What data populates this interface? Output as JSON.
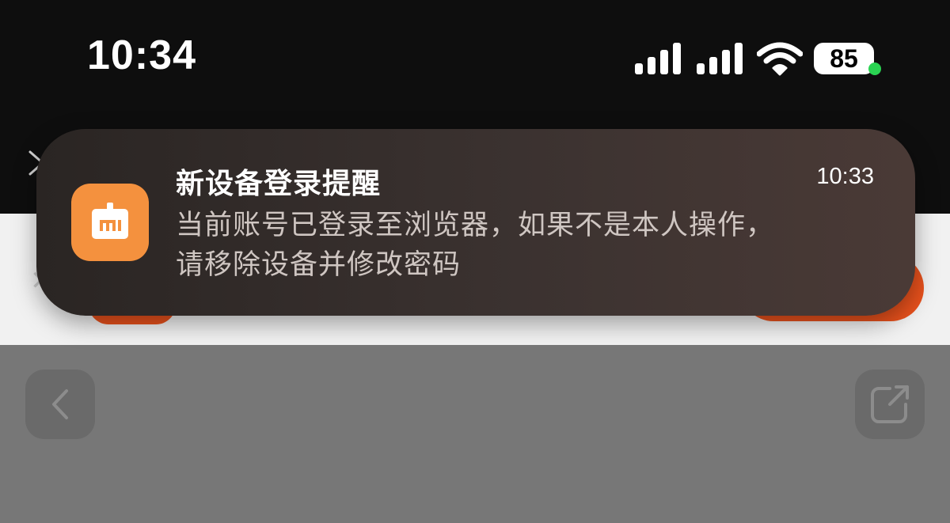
{
  "status_bar": {
    "time": "10:34",
    "battery": "85",
    "icons": [
      "cellular-signal-icon",
      "cellular-signal-icon",
      "wifi-icon",
      "battery-icon"
    ]
  },
  "notification": {
    "title": "新设备登录提醒",
    "time": "10:33",
    "body_line1": "当前账号已登录至浏览器，如果不是本人操作，",
    "body_line2": "请移除设备并修改密码",
    "app_icon": "xiaomi-account-icon"
  },
  "toolbar": {
    "back_icon": "chevron-left-icon",
    "share_icon": "external-link-icon"
  },
  "colors": {
    "notification_bg": "#3b3230",
    "app_icon_bg": "#f4913e",
    "accent_orange": "#e8511c",
    "battery_dot": "#2ad352"
  }
}
